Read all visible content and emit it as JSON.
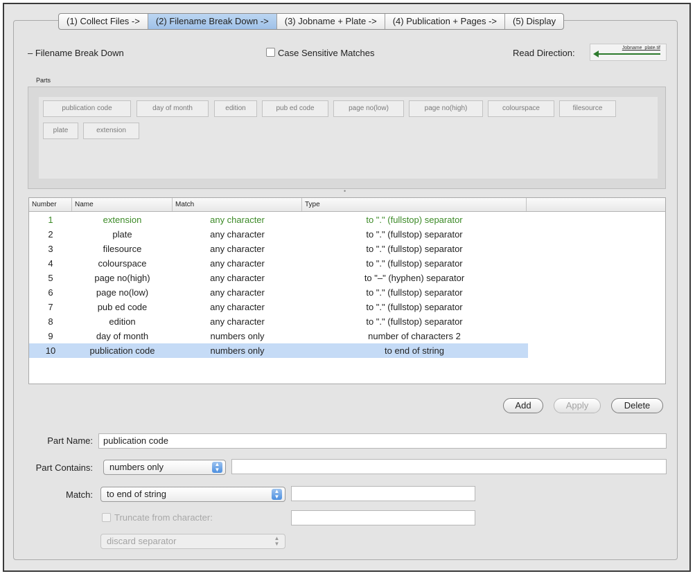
{
  "tabs": [
    {
      "label": "(1) Collect Files ->",
      "active": false
    },
    {
      "label": "(2) Filename Break Down ->",
      "active": true
    },
    {
      "label": "(3) Jobname + Plate ->",
      "active": false
    },
    {
      "label": "(4) Publication + Pages ->",
      "active": false
    },
    {
      "label": "(5) Display",
      "active": false
    }
  ],
  "section": {
    "title": "– Filename Break Down",
    "case_sensitive_label": "Case Sensitive Matches",
    "read_direction_label": "Read Direction:",
    "read_direction_filename": "Jobname_plate.tif"
  },
  "parts": {
    "label": "Parts",
    "chips": [
      "publication code",
      "day of month",
      "edition",
      "pub ed code",
      "page no(low)",
      "page no(high)",
      "colourspace",
      "filesource",
      "plate",
      "extension"
    ]
  },
  "table": {
    "columns": [
      "Number",
      "Name",
      "Match",
      "Type"
    ],
    "rows": [
      {
        "number": "1",
        "name": "extension",
        "match": "any character",
        "type": "to \".\" (fullstop) separator"
      },
      {
        "number": "2",
        "name": "plate",
        "match": "any character",
        "type": "to \".\" (fullstop) separator"
      },
      {
        "number": "3",
        "name": "filesource",
        "match": "any character",
        "type": "to \".\" (fullstop) separator"
      },
      {
        "number": "4",
        "name": "colourspace",
        "match": "any character",
        "type": "to \".\" (fullstop) separator"
      },
      {
        "number": "5",
        "name": "page no(high)",
        "match": "any character",
        "type": "to \"–\" (hyphen) separator"
      },
      {
        "number": "6",
        "name": "page no(low)",
        "match": "any character",
        "type": "to \".\" (fullstop) separator"
      },
      {
        "number": "7",
        "name": "pub ed code",
        "match": "any character",
        "type": "to \".\" (fullstop) separator"
      },
      {
        "number": "8",
        "name": "edition",
        "match": "any character",
        "type": "to \".\" (fullstop) separator"
      },
      {
        "number": "9",
        "name": "day of month",
        "match": "numbers only",
        "type": "number of characters 2"
      },
      {
        "number": "10",
        "name": "publication code",
        "match": "numbers only",
        "type": "to end of string"
      }
    ]
  },
  "buttons": {
    "add": "Add",
    "apply": "Apply",
    "delete": "Delete"
  },
  "form": {
    "part_name_label": "Part Name:",
    "part_name_value": "publication code",
    "part_contains_label": "Part Contains:",
    "part_contains_value": "numbers only",
    "match_label": "Match:",
    "match_value": "to end of string",
    "truncate_label": "Truncate from character:",
    "separator_value": "discard separator"
  },
  "colors": {
    "accent": "#9fc1e8",
    "selected_row": "#c5dbf6",
    "first_row_text": "#3c8a27"
  }
}
